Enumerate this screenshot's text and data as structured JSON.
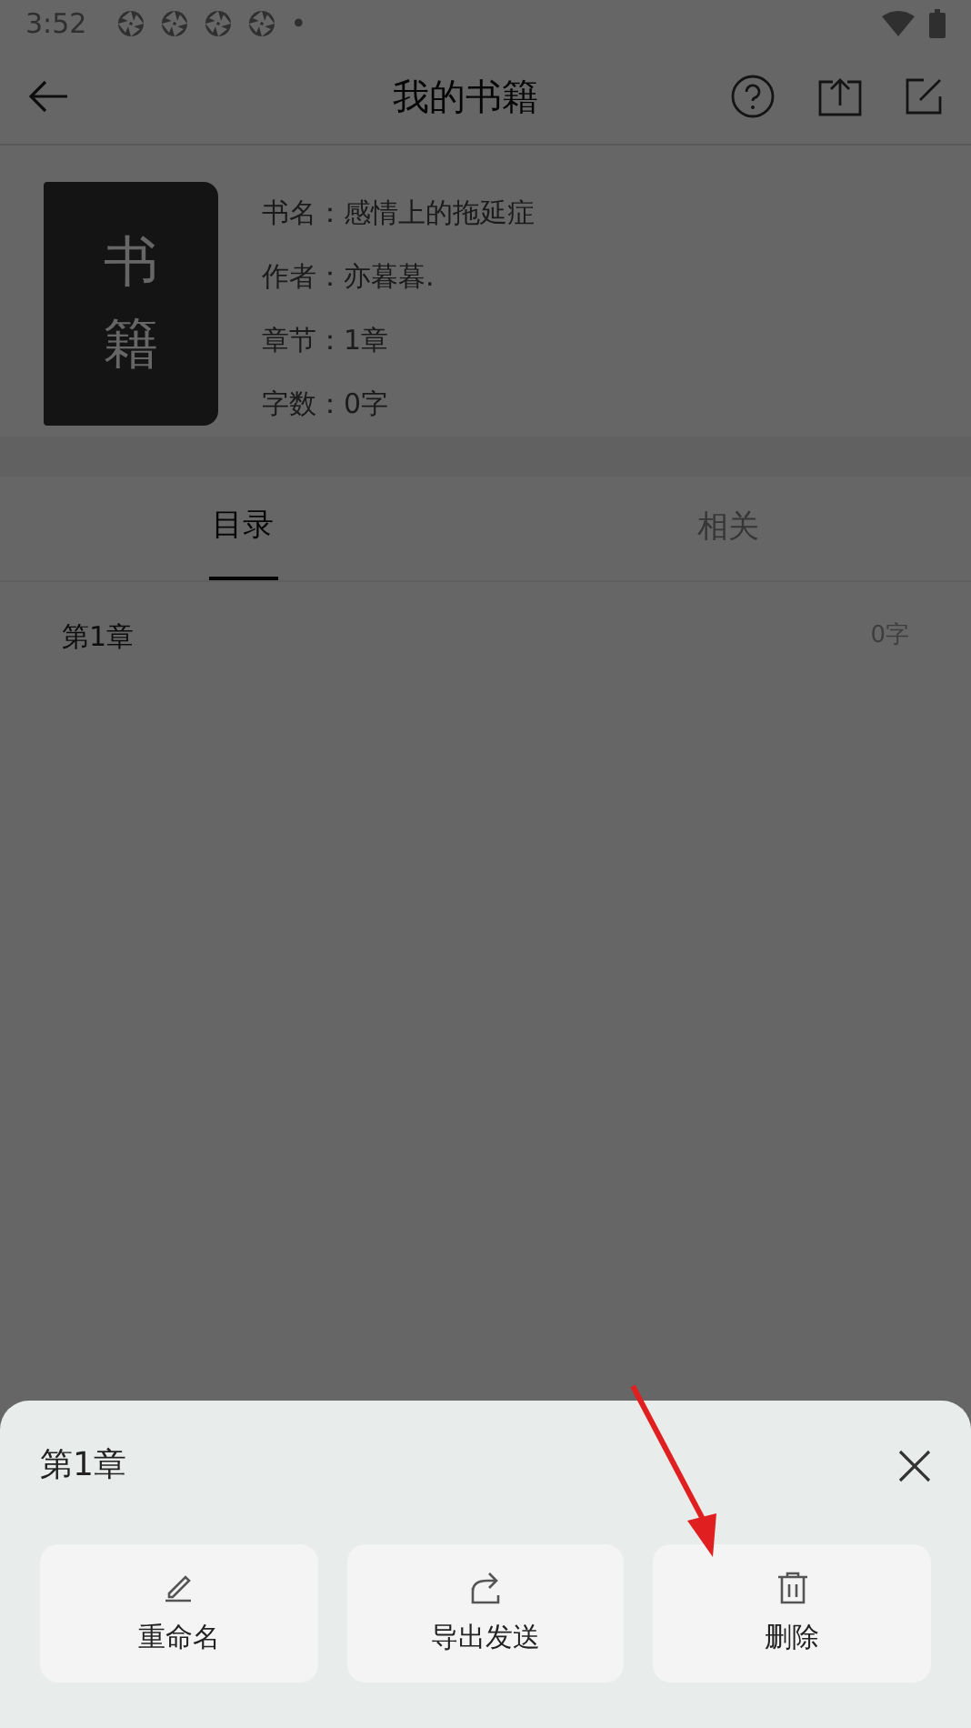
{
  "status_bar": {
    "time": "3:52",
    "dot": "•"
  },
  "toolbar": {
    "title": "我的书籍"
  },
  "book": {
    "cover_chars": [
      "书",
      "籍"
    ],
    "fields": [
      {
        "label": "书名：",
        "value": "感情上的拖延症"
      },
      {
        "label": "作者：",
        "value": "亦暮暮."
      },
      {
        "label": "章节：",
        "value": "1章"
      },
      {
        "label": "字数：",
        "value": "0字"
      }
    ]
  },
  "tabs": [
    {
      "label": "目录",
      "selected": true
    },
    {
      "label": "相关",
      "selected": false
    }
  ],
  "chapters": [
    {
      "title": "第1章",
      "count": "0字"
    }
  ],
  "sheet": {
    "title": "第1章",
    "actions": [
      {
        "kind": "rename",
        "label": "重命名"
      },
      {
        "kind": "export",
        "label": "导出发送"
      },
      {
        "kind": "delete",
        "label": "删除"
      }
    ]
  }
}
